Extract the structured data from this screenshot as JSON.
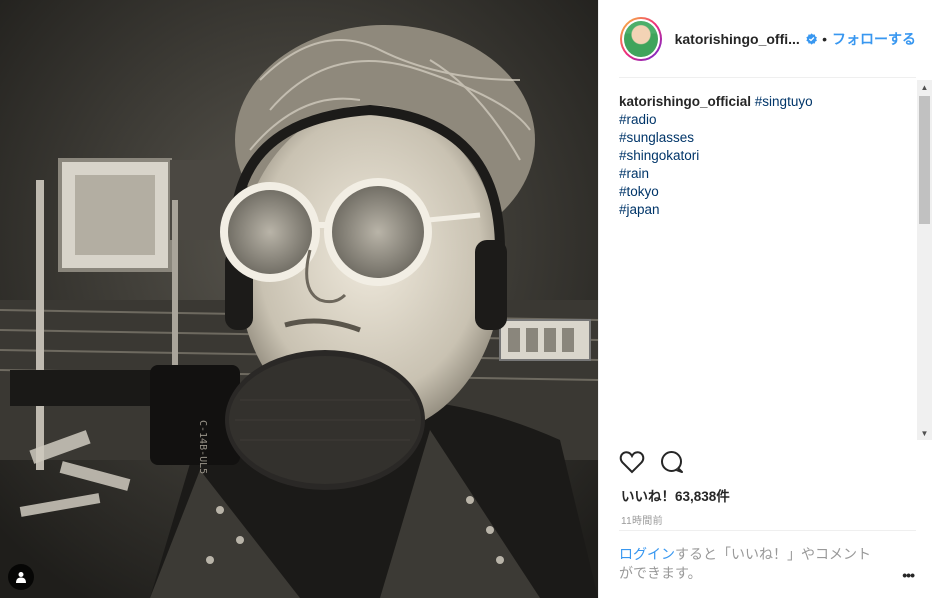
{
  "post": {
    "username": "katorishingo_offi...",
    "follow_label": "フォローする",
    "separator": "•",
    "caption_user": "katorishingo_official",
    "caption_first_tag": "#singtuyo",
    "hashtags": [
      "#radio",
      "#sunglasses",
      "#shingokatori",
      "#rain",
      "#tokyo",
      "#japan"
    ],
    "likes": "いいね！63,838件",
    "time_ago": "11時間前",
    "login_link": "ログイン",
    "login_rest": "すると「いいね！」やコメントができます。",
    "more_label": "•••"
  },
  "icons": {
    "like": "heart-icon",
    "comment": "comment-icon",
    "verified": "verified-badge-icon",
    "user_tag": "user-tag-icon"
  },
  "colors": {
    "link": "#3897f0",
    "hashtag": "#003569",
    "muted": "#999999"
  }
}
